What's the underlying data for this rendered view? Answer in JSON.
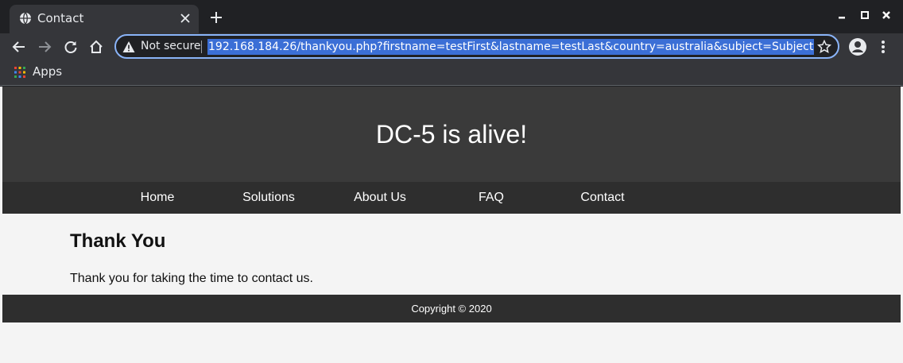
{
  "browser": {
    "tab_title": "Contact",
    "not_secure_label": "Not secure",
    "url": "192.168.184.26/thankyou.php?firstname=testFirst&lastname=testLast&country=australia&subject=Subject",
    "bookmarks": [
      {
        "label": "Apps"
      }
    ]
  },
  "site": {
    "header_title": "DC-5 is alive!",
    "nav": [
      {
        "label": "Home"
      },
      {
        "label": "Solutions"
      },
      {
        "label": "About Us"
      },
      {
        "label": "FAQ"
      },
      {
        "label": "Contact"
      }
    ],
    "heading": "Thank You",
    "message": "Thank you for taking the time to contact us.",
    "footer": "Copyright © 2020"
  },
  "colors": {
    "chrome_bg": "#202124",
    "toolbar_bg": "#35363a",
    "omnibox_focus": "#8ab4f8",
    "url_selection": "#3b6fd6",
    "header_bg": "#3a3a3a",
    "nav_bg": "#2e2e2e",
    "page_bg": "#f4f4f4"
  }
}
